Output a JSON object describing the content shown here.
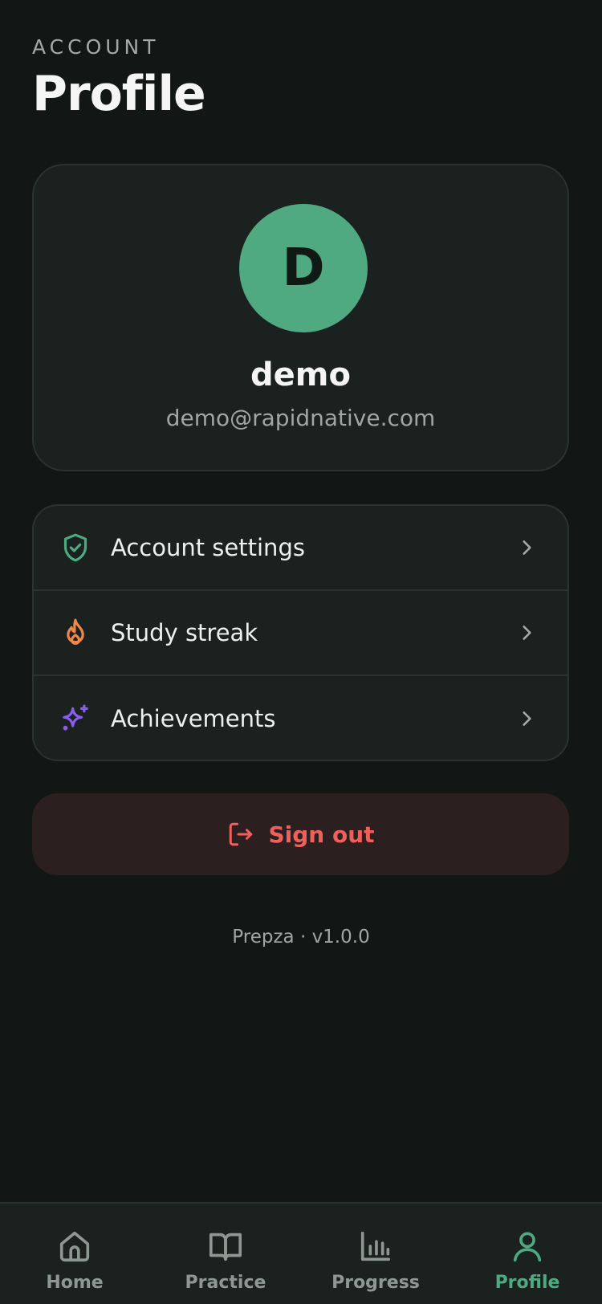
{
  "header": {
    "eyebrow": "ACCOUNT",
    "title": "Profile"
  },
  "profile": {
    "avatar_initial": "D",
    "name": "demo",
    "email": "demo@rapidnative.com"
  },
  "menu": [
    {
      "label": "Account settings",
      "icon": "shield-check-icon",
      "icon_color": "#4faa82"
    },
    {
      "label": "Study streak",
      "icon": "flame-icon",
      "icon_color": "#f0884a"
    },
    {
      "label": "Achievements",
      "icon": "sparkles-icon",
      "icon_color": "#8a5cf0"
    }
  ],
  "signout": {
    "label": "Sign out",
    "icon": "log-out-icon",
    "color": "#ef5f5c"
  },
  "footer": {
    "version": "Prepza · v1.0.0"
  },
  "tabbar": {
    "tabs": [
      {
        "label": "Home",
        "icon": "home-icon",
        "active": false
      },
      {
        "label": "Practice",
        "icon": "book-open-icon",
        "active": false
      },
      {
        "label": "Progress",
        "icon": "bar-chart-icon",
        "active": false
      },
      {
        "label": "Profile",
        "icon": "user-icon",
        "active": true
      }
    ]
  },
  "colors": {
    "background": "#121716",
    "card": "#1a211f",
    "accent": "#4faa82",
    "danger": "#ef5f5c"
  }
}
